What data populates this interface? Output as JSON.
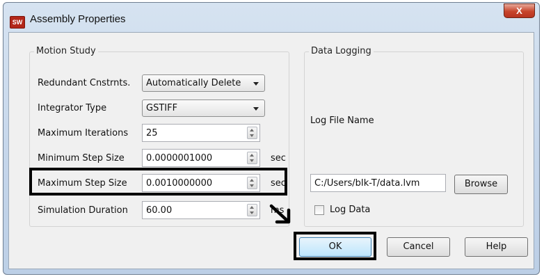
{
  "window": {
    "title": "Assembly Properties",
    "app_icon_text": "SW",
    "close_glyph": "X"
  },
  "motion_study": {
    "group_label": "Motion Study",
    "redundant": {
      "label": "Redundant Cnstrnts.",
      "value": "Automatically Delete"
    },
    "integrator": {
      "label": "Integrator Type",
      "value": "GSTIFF"
    },
    "max_iterations": {
      "label": "Maximum Iterations",
      "value": "25"
    },
    "min_step": {
      "label": "Minimum Step Size",
      "value": "0.0000001000",
      "unit": "sec"
    },
    "max_step": {
      "label": "Maximum Step Size",
      "value": "0.0010000000",
      "unit": "sec"
    },
    "sim_duration": {
      "label": "Simulation Duration",
      "value": "60.00",
      "unit": "ms"
    }
  },
  "data_logging": {
    "group_label": "Data Logging",
    "log_file_label": "Log File Name",
    "log_file_value": "C:/Users/bIk-T/data.lvm",
    "browse_label": "Browse",
    "log_data_label": "Log Data",
    "log_data_checked": false
  },
  "buttons": {
    "ok": "OK",
    "cancel": "Cancel",
    "help": "Help"
  },
  "annotations": {
    "highlight_color": "#000000",
    "icons": [
      "arrow-down-right-icon"
    ]
  }
}
